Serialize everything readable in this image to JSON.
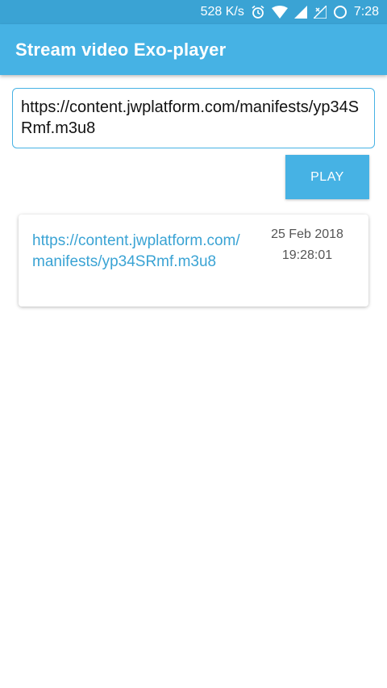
{
  "status_bar": {
    "net_speed": "528 K/s",
    "time": "7:28"
  },
  "app_bar": {
    "title": "Stream video Exo-player"
  },
  "url_input": {
    "value": "https://content.jwplatform.com/manifests/yp34SRmf.m3u8"
  },
  "play_button": {
    "label": "PLAY"
  },
  "history": [
    {
      "url": "https://content.jwplatform.com/manifests/yp34SRmf.m3u8",
      "date": "25 Feb 2018",
      "time": "19:28:01"
    }
  ],
  "colors": {
    "primary": "#46b2e4",
    "primary_dark": "#3aa3d4",
    "link": "#3aa3d4"
  },
  "icons": [
    "alarm-icon",
    "wifi-icon",
    "signal-icon",
    "signal-no-data-icon",
    "battery-icon"
  ]
}
